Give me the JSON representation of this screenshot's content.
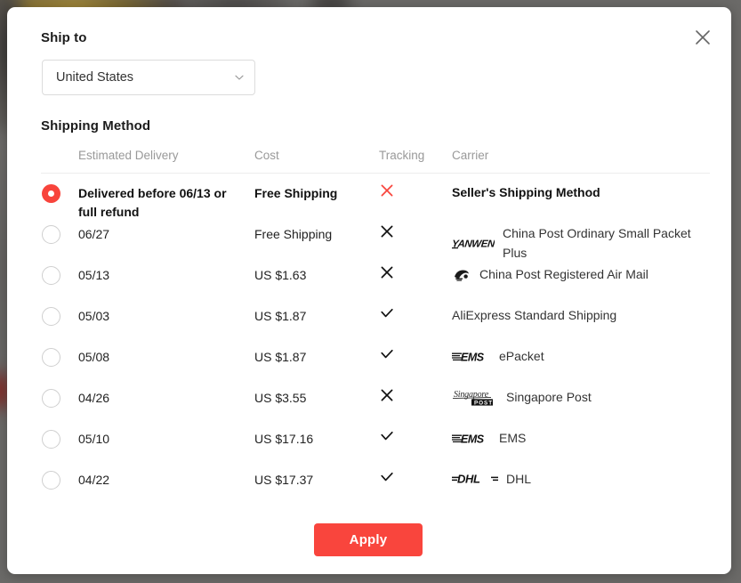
{
  "backdrop": {
    "color": "#6b6a68"
  },
  "modal": {
    "close_icon": "close-icon",
    "ship_to": {
      "title": "Ship to",
      "country": "United States",
      "chevron_icon": "chevron-down-icon"
    },
    "shipping_method": {
      "title": "Shipping Method",
      "columns": {
        "estimated_delivery": "Estimated Delivery",
        "cost": "Cost",
        "tracking": "Tracking",
        "carrier": "Carrier"
      },
      "rows": [
        {
          "selected": true,
          "estimated_delivery": "Delivered before 06/13 or full refund",
          "cost": "Free Shipping",
          "tracking": "x",
          "tracking_color": "#f8443c",
          "logo": "none",
          "carrier": "Seller's Shipping Method"
        },
        {
          "selected": false,
          "estimated_delivery": "06/27",
          "cost": "Free Shipping",
          "tracking": "x",
          "tracking_color": "#111111",
          "logo": "yanwen-logo",
          "carrier": "China Post Ordinary Small Packet Plus"
        },
        {
          "selected": false,
          "estimated_delivery": "05/13",
          "cost": "US $1.63",
          "tracking": "x",
          "tracking_color": "#111111",
          "logo": "china-post-logo",
          "carrier": "China Post Registered Air Mail"
        },
        {
          "selected": false,
          "estimated_delivery": "05/03",
          "cost": "US $1.87",
          "tracking": "check",
          "tracking_color": "#111111",
          "logo": "none",
          "carrier": "AliExpress Standard Shipping"
        },
        {
          "selected": false,
          "estimated_delivery": "05/08",
          "cost": "US $1.87",
          "tracking": "check",
          "tracking_color": "#111111",
          "logo": "ems-logo",
          "carrier": "ePacket"
        },
        {
          "selected": false,
          "estimated_delivery": "04/26",
          "cost": "US $3.55",
          "tracking": "x",
          "tracking_color": "#111111",
          "logo": "singapore-post-logo",
          "carrier": "Singapore Post"
        },
        {
          "selected": false,
          "estimated_delivery": "05/10",
          "cost": "US $17.16",
          "tracking": "check",
          "tracking_color": "#111111",
          "logo": "ems-logo",
          "carrier": "EMS"
        },
        {
          "selected": false,
          "estimated_delivery": "04/22",
          "cost": "US $17.37",
          "tracking": "check",
          "tracking_color": "#111111",
          "logo": "dhl-logo",
          "carrier": "DHL"
        }
      ]
    },
    "apply_label": "Apply",
    "accent_color": "#f9453d"
  }
}
